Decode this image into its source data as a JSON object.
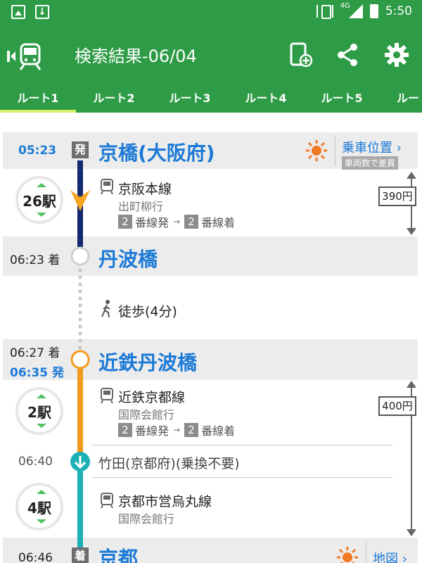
{
  "status": {
    "time": "5:50",
    "network": "4G"
  },
  "appbar": {
    "title": "検索結果-06/04"
  },
  "tabs": [
    "ルート1",
    "ルート2",
    "ルート3",
    "ルート4",
    "ルート5",
    "ルー"
  ],
  "origin": {
    "time": "05:23",
    "badge": "発",
    "name": "京橋(大阪府)",
    "link": "乗車位置",
    "link_sub": "車両数で差異"
  },
  "segment1": {
    "stops": "26駅",
    "line": "京阪本線",
    "destination": "出町柳行",
    "dep_platform": "2",
    "dep_suffix": "番線発",
    "arr_platform": "2",
    "arr_suffix": "番線着",
    "fare": "390円"
  },
  "transfer1": {
    "time": "06:23 着",
    "name": "丹波橋"
  },
  "walk": {
    "text": "徒歩(4分)"
  },
  "transfer2": {
    "arr_time": "06:27 着",
    "dep_time": "06:35 発",
    "name": "近鉄丹波橋"
  },
  "segment2": {
    "stops": "2駅",
    "line": "近鉄京都線",
    "destination": "国際会館行",
    "dep_platform": "2",
    "dep_suffix": "番線発",
    "arr_platform": "2",
    "arr_suffix": "番線着",
    "fare": "400円"
  },
  "through": {
    "time": "06:40",
    "name": "竹田(京都府)(乗換不要)"
  },
  "segment3": {
    "stops": "4駅",
    "line": "京都市営烏丸線",
    "destination": "国際会館行"
  },
  "destination": {
    "time": "06:46",
    "badge": "着",
    "name": "京都",
    "link": "地図"
  },
  "colors": {
    "brand": "#2e9b46",
    "line_keihan": "#142a6e",
    "line_kintetsu": "#f29a1e",
    "line_karasuma": "#1eb0b5",
    "station_link": "#1c7ad6"
  }
}
